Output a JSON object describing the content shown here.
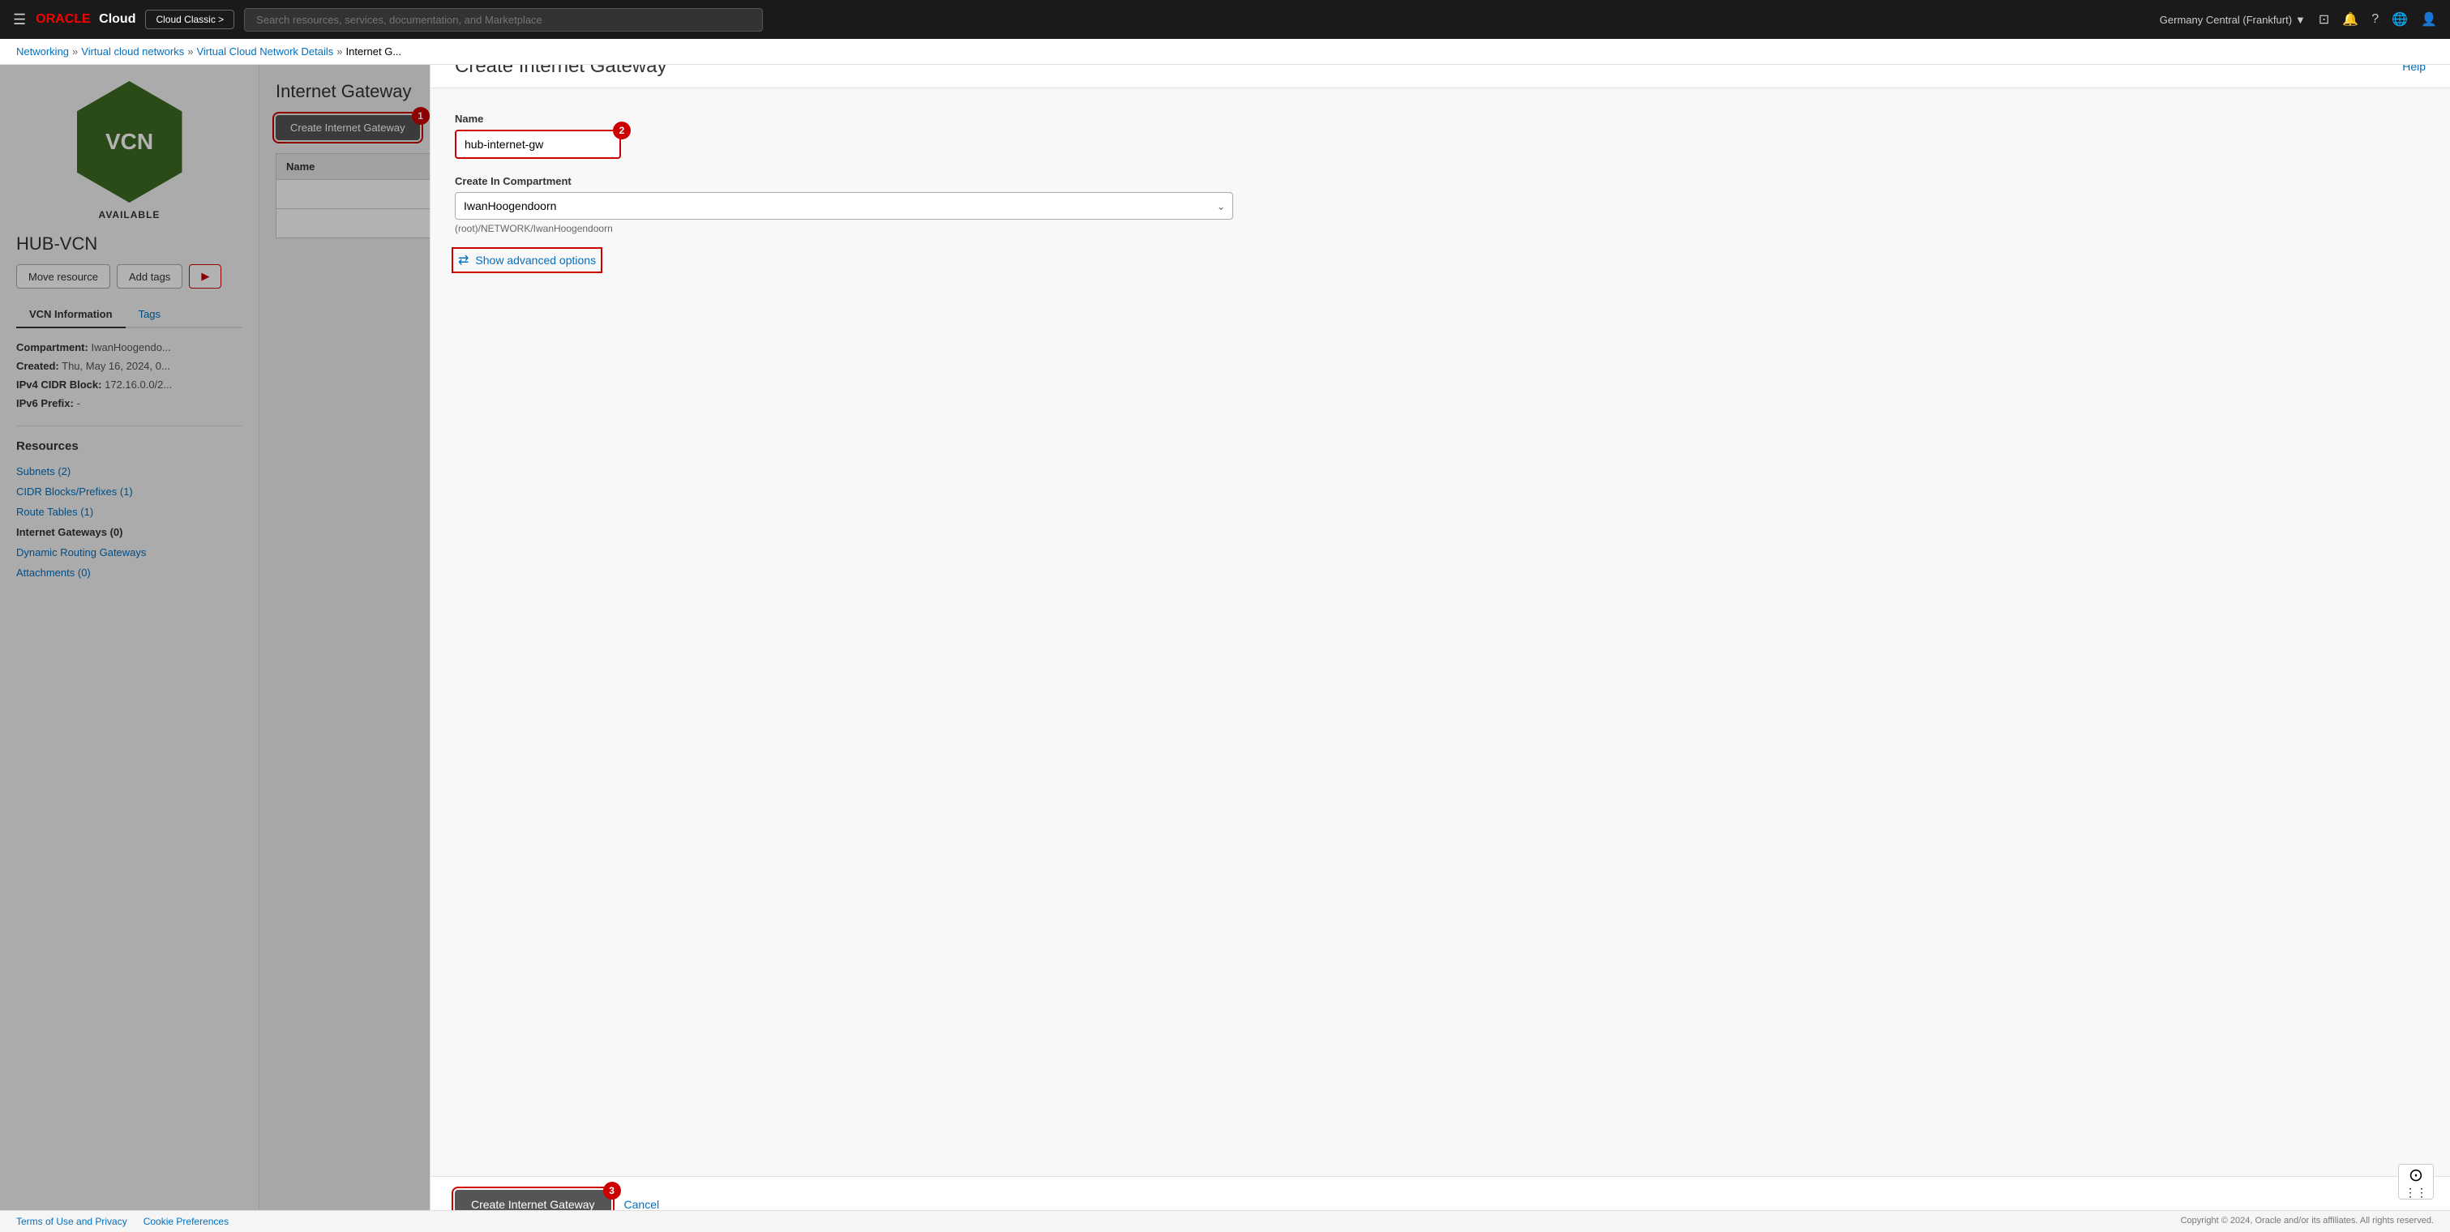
{
  "topnav": {
    "hamburger": "☰",
    "oracle_logo": "ORACLE Cloud",
    "cloud_classic_label": "Cloud Classic >",
    "search_placeholder": "Search resources, services, documentation, and Marketplace",
    "region": "Germany Central (Frankfurt)",
    "region_icon": "▼",
    "console_icon": "⊡",
    "bell_icon": "🔔",
    "help_icon": "?",
    "globe_icon": "🌐",
    "user_icon": "👤"
  },
  "breadcrumb": {
    "networking": "Networking",
    "vcns": "Virtual cloud networks",
    "vcn_details": "Virtual Cloud Network Details",
    "current": "Internet G..."
  },
  "left_panel": {
    "vcn_hex_text": "VCN",
    "vcn_status": "AVAILABLE",
    "vcn_name": "HUB-VCN",
    "btn_move": "Move resource",
    "btn_tags": "Add tags",
    "btn_more": "...",
    "tab_vcn_info": "VCN Information",
    "tab_tags": "Tags",
    "compartment_label": "Compartment:",
    "compartment_value": "IwanHoogendo...",
    "created_label": "Created:",
    "created_value": "Thu, May 16, 2024, 0...",
    "ipv4_label": "IPv4 CIDR Block:",
    "ipv4_value": "172.16.0.0/2...",
    "ipv6_label": "IPv6 Prefix:",
    "ipv6_value": "-",
    "resources_title": "Resources",
    "resource_items": [
      {
        "label": "Subnets (2)",
        "active": false
      },
      {
        "label": "CIDR Blocks/Prefixes (1)",
        "active": false
      },
      {
        "label": "Route Tables (1)",
        "active": false
      },
      {
        "label": "Internet Gateways (0)",
        "active": true
      },
      {
        "label": "Dynamic Routing Gateways",
        "active": false
      },
      {
        "label": "Attachments (0)",
        "active": false
      }
    ]
  },
  "content": {
    "section_title": "Internet Gateway",
    "create_btn_label": "Create Internet Gateway",
    "table_col_name": "Name"
  },
  "modal": {
    "title": "Create Internet Gateway",
    "help_label": "Help",
    "name_label": "Name",
    "name_value": "hub-internet-gw",
    "compartment_label": "Create In Compartment",
    "compartment_value": "IwanHoogendoorn",
    "compartment_hint": "(root)/NETWORK/IwanHoogendoorn",
    "advanced_label": "Show advanced options",
    "create_btn_label": "Create Internet Gateway",
    "cancel_label": "Cancel"
  },
  "footer": {
    "terms": "Terms of Use and Privacy",
    "cookies": "Cookie Preferences",
    "copyright": "Copyright © 2024, Oracle and/or its affiliates. All rights reserved."
  },
  "step_badges": {
    "step1": "1",
    "step2": "2",
    "step3": "3"
  }
}
